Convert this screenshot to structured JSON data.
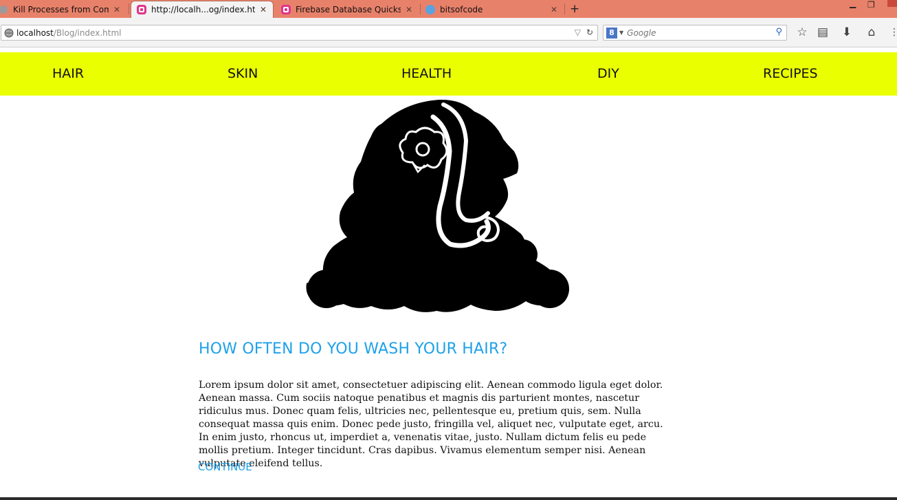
{
  "browser": {
    "tabs": [
      {
        "label": "Kill Processes from Comm...",
        "icon": "generic-page-icon",
        "active": false
      },
      {
        "label": "http://localh...og/index.html",
        "icon": "pink-app-icon",
        "active": true
      },
      {
        "label": "Firebase Database Quickstart",
        "icon": "pink-app-icon",
        "active": false
      },
      {
        "label": "bitsofcode",
        "icon": "blue-circle-icon",
        "active": false
      }
    ],
    "close_glyph": "✕",
    "new_tab_glyph": "+",
    "url": {
      "host": "localhost",
      "path": "/Blog/index.html"
    },
    "search": {
      "engine_glyph": "8",
      "placeholder": "Google"
    },
    "colors": {
      "tabbar": "#e8816a",
      "toolbar": "#f3f3f3"
    }
  },
  "site": {
    "nav": [
      "HAIR",
      "SKIN",
      "HEALTH",
      "DIY",
      "RECIPES"
    ],
    "nav_color": "#eaff00",
    "accent": "#1ea1ea",
    "article": {
      "title": "HOW OFTEN DO YOU WASH YOUR HAIR?",
      "body": "Lorem ipsum dolor sit amet, consectetuer adipiscing elit. Aenean commodo ligula eget dolor. Aenean massa. Cum sociis natoque penatibus et magnis dis parturient montes, nascetur ridiculus mus. Donec quam felis, ultricies nec, pellentesque eu, pretium quis, sem. Nulla consequat massa quis enim. Donec pede justo, fringilla vel, aliquet nec, vulputate eget, arcu. In enim justo, rhoncus ut, imperdiet a, venenatis vitae, justo. Nullam dictum felis eu pede mollis pretium. Integer tincidunt. Cras dapibus. Vivamus elementum semper nisi. Aenean vulputate eleifend tellus.",
      "link": "CONTINUE"
    }
  }
}
